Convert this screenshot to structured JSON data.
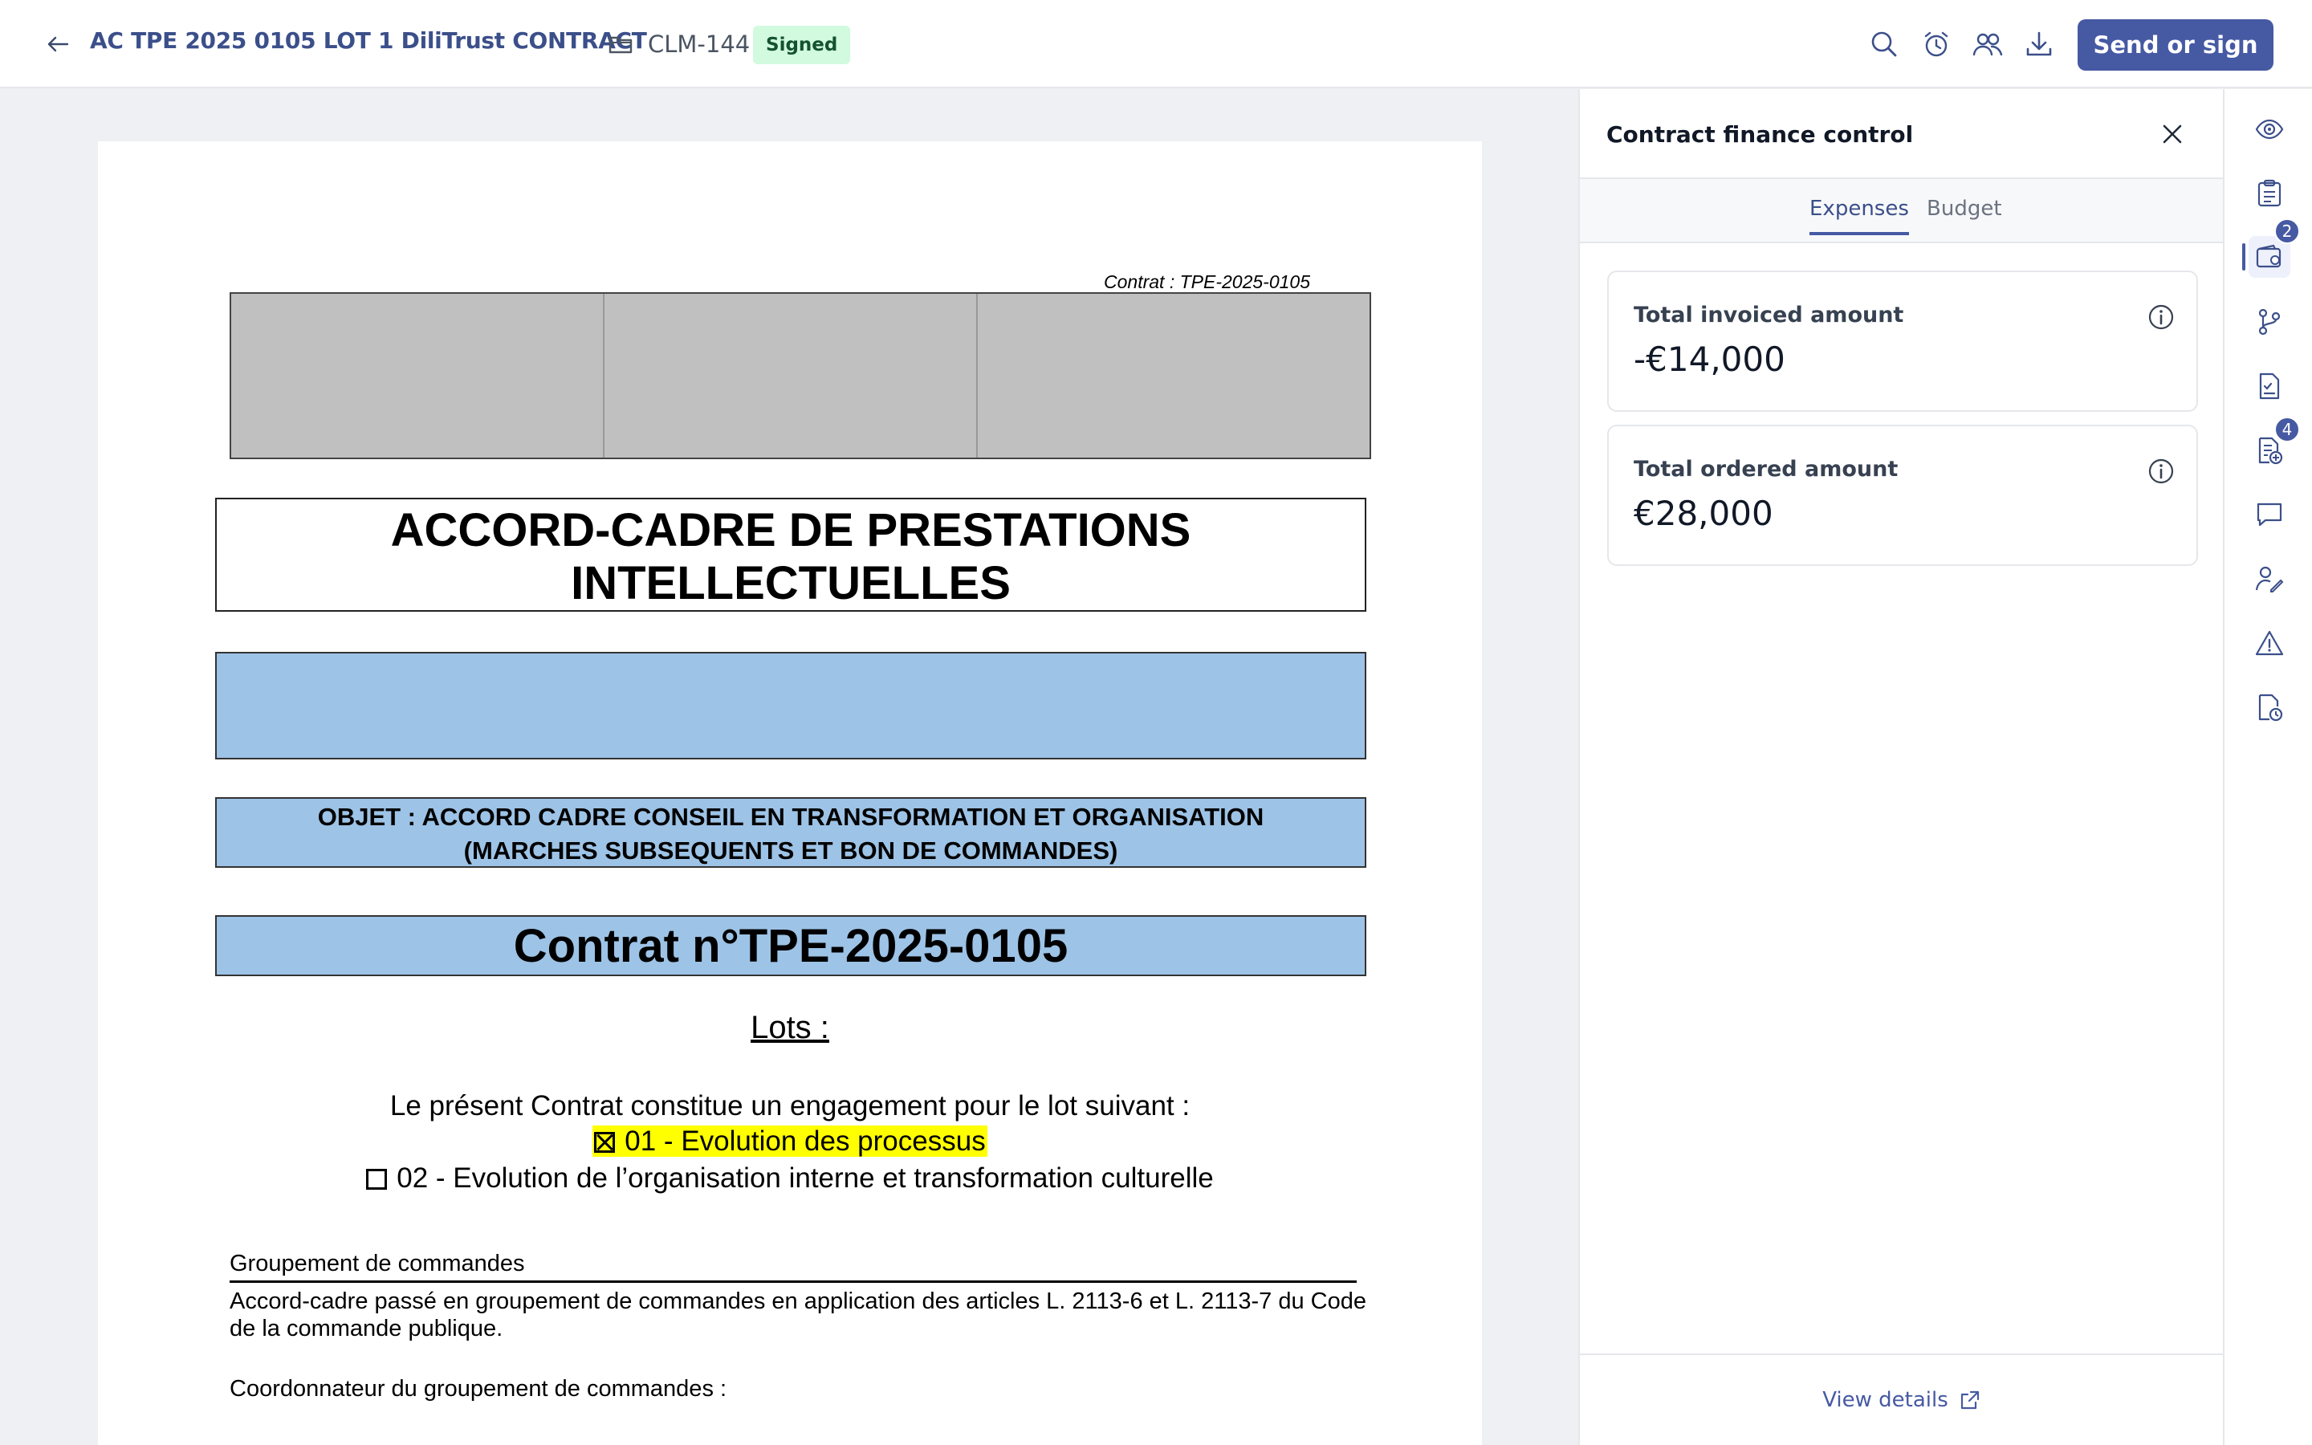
{
  "header": {
    "title": "AC TPE 2025 0105 LOT 1 DiliTrust CONTRACT",
    "contract_id": "CLM-144",
    "status": "Signed",
    "send_button": "Send or sign",
    "icons": [
      "search-icon",
      "alarm-icon",
      "users-icon",
      "download-icon"
    ]
  },
  "document": {
    "contrat_ref": "Contrat : TPE-2025-0105",
    "title_line1": "ACCORD-CADRE DE PRESTATIONS",
    "title_line2": "INTELLECTUELLES",
    "objet_line1": "OBJET : ACCORD CADRE CONSEIL EN TRANSFORMATION ET ORGANISATION",
    "objet_line2": "(MARCHES SUBSEQUENTS ET BON DE COMMANDES)",
    "contrat_number": "Contrat n°TPE-2025-0105",
    "lots_title": "Lots :",
    "lot_intro": "Le présent Contrat constitue un engagement pour le lot suivant :",
    "lot1": "01 - Evolution des processus",
    "lot2": "02 - Evolution de l’organisation interne et transformation culturelle",
    "group_title": "Groupement de commandes",
    "group_text": "Accord-cadre passé en groupement de commandes en application des articles L. 2113-6 et L. 2113-7 du Code de la commande publique.",
    "group_coord": "Coordonnateur du groupement de commandes :"
  },
  "panel": {
    "title": "Contract finance control",
    "tabs": [
      {
        "label": "Expenses",
        "active": true
      },
      {
        "label": "Budget",
        "active": false
      }
    ],
    "cards": [
      {
        "label": "Total invoiced amount",
        "value": "-€14,000"
      },
      {
        "label": "Total ordered amount",
        "value": "€28,000"
      }
    ],
    "footer_link": "View details"
  },
  "rail": {
    "items": [
      "eye-icon",
      "clipboard-icon",
      "wallet-icon",
      "branch-icon",
      "doc-check-icon",
      "doc-add-icon",
      "comment-icon",
      "signature-icon",
      "warning-icon",
      "doc-clock-icon"
    ],
    "badges": {
      "wallet": "2",
      "doc_add": "4"
    }
  },
  "colors": {
    "accent": "#4659a3",
    "signed_bg": "#d1fadf",
    "doc_blue": "#9dc3e6",
    "highlight": "#ffff00"
  }
}
